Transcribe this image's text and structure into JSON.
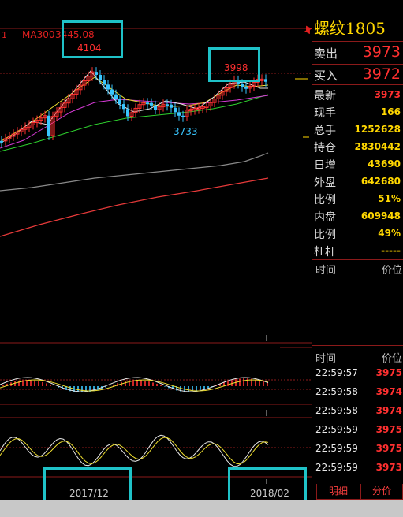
{
  "chart": {
    "ma_label": "MA300",
    "ma_value": "3445.08",
    "left_marker": "1",
    "high_label": "4104",
    "recent_high_label": "3998",
    "low_label": "3733",
    "date_labels": [
      "2017/12",
      "2018/02"
    ]
  },
  "quote": {
    "contract": "螺纹1805",
    "sell_label": "卖出",
    "sell_value": "3973",
    "buy_label": "买入",
    "buy_value": "3972",
    "stats": [
      {
        "label": "最新",
        "value": "3973",
        "color": "#ff3030"
      },
      {
        "label": "现手",
        "value": "166",
        "color": "#ffd700"
      },
      {
        "label": "总手",
        "value": "1252628",
        "color": "#ffd700"
      },
      {
        "label": "持仓",
        "value": "2830442",
        "color": "#ffd700"
      },
      {
        "label": "日增",
        "value": "43690",
        "color": "#ffd700"
      },
      {
        "label": "外盘",
        "value": "642680",
        "color": "#ffd700"
      },
      {
        "label": "比例",
        "value": "51%",
        "color": "#ffd700"
      },
      {
        "label": "内盘",
        "value": "609948",
        "color": "#ffd700"
      },
      {
        "label": "比例",
        "value": "49%",
        "color": "#ffd700"
      },
      {
        "label": "杠杆",
        "value": "-----",
        "color": "#ffd700"
      }
    ]
  },
  "ticks_header_1": {
    "time": "时间",
    "price": "价位"
  },
  "ticks_header_2": {
    "time": "时间",
    "price": "价位"
  },
  "ticks": [
    {
      "time": "22:59:57",
      "price": "3975"
    },
    {
      "time": "22:59:58",
      "price": "3974"
    },
    {
      "time": "22:59:58",
      "price": "3974"
    },
    {
      "time": "22:59:59",
      "price": "3975"
    },
    {
      "time": "22:59:59",
      "price": "3975"
    },
    {
      "time": "22:59:59",
      "price": "3973"
    }
  ],
  "tabs": [
    "明细",
    "分价"
  ],
  "colors": {
    "up": "#ff3030",
    "down": "#39c6ff",
    "highlight_box": "#1fc2c8",
    "accent": "#ffd700",
    "grid": "#8b1a1a"
  }
}
